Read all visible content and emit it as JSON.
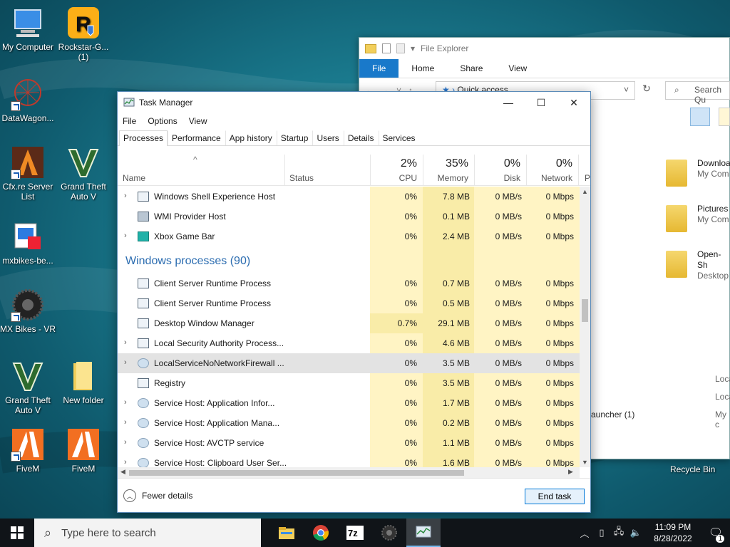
{
  "desktop": {
    "icons": [
      {
        "label": "My Computer"
      },
      {
        "label": "Rockstar-G... (1)"
      },
      {
        "label": "DataWagon..."
      },
      {
        "label": "Cfx.re Server List"
      },
      {
        "label": "Grand Theft Auto V"
      },
      {
        "label": "mxbikes-be..."
      },
      {
        "label": "MX Bikes - VR"
      },
      {
        "label": "Grand Theft Auto V"
      },
      {
        "label": "New folder"
      },
      {
        "label": "FiveM"
      },
      {
        "label": "FiveM"
      }
    ],
    "recycle_label": "Recycle Bin"
  },
  "explorer": {
    "title": "File Explorer",
    "tabs": [
      "File",
      "Home",
      "Share",
      "View"
    ],
    "path": "Quick access",
    "search_placeholder": "Search Qu",
    "items": [
      {
        "name": "Downloa",
        "sub": "My Com"
      },
      {
        "name": "Pictures",
        "sub": "My Com"
      },
      {
        "name": "Open-Sh",
        "sub": "Desktop"
      }
    ],
    "recent": [
      "Loca",
      "Loca",
      "My c"
    ],
    "launcher_label": "auncher (1)"
  },
  "taskmanager": {
    "title": "Task Manager",
    "menu": [
      "File",
      "Options",
      "View"
    ],
    "tabs": [
      "Processes",
      "Performance",
      "App history",
      "Startup",
      "Users",
      "Details",
      "Services"
    ],
    "columns": {
      "name": "Name",
      "status": "Status",
      "cpu": {
        "pct": "2%",
        "label": "CPU"
      },
      "memory": {
        "pct": "35%",
        "label": "Memory"
      },
      "disk": {
        "pct": "0%",
        "label": "Disk"
      },
      "network": {
        "pct": "0%",
        "label": "Network"
      },
      "next": "P"
    },
    "rows_top": [
      {
        "name": "Windows Shell Experience Host",
        "cpu": "0%",
        "mem": "7.8 MB",
        "disk": "0 MB/s",
        "net": "0 Mbps",
        "expand": true,
        "icon": "window"
      },
      {
        "name": "WMI Provider Host",
        "cpu": "0%",
        "mem": "0.1 MB",
        "disk": "0 MB/s",
        "net": "0 Mbps",
        "expand": false,
        "icon": "wmi"
      },
      {
        "name": "Xbox Game Bar",
        "cpu": "0%",
        "mem": "2.4 MB",
        "disk": "0 MB/s",
        "net": "0 Mbps",
        "expand": true,
        "icon": "xbox"
      }
    ],
    "group_label": "Windows processes (90)",
    "rows_win": [
      {
        "name": "Client Server Runtime Process",
        "cpu": "0%",
        "mem": "0.7 MB",
        "disk": "0 MB/s",
        "net": "0 Mbps",
        "expand": false,
        "icon": "window"
      },
      {
        "name": "Client Server Runtime Process",
        "cpu": "0%",
        "mem": "0.5 MB",
        "disk": "0 MB/s",
        "net": "0 Mbps",
        "expand": false,
        "icon": "window"
      },
      {
        "name": "Desktop Window Manager",
        "cpu": "0.7%",
        "mem": "29.1 MB",
        "disk": "0 MB/s",
        "net": "0 Mbps",
        "expand": false,
        "icon": "window"
      },
      {
        "name": "Local Security Authority Process...",
        "cpu": "0%",
        "mem": "4.6 MB",
        "disk": "0 MB/s",
        "net": "0 Mbps",
        "expand": true,
        "icon": "window"
      },
      {
        "name": "LocalServiceNoNetworkFirewall ...",
        "cpu": "0%",
        "mem": "3.5 MB",
        "disk": "0 MB/s",
        "net": "0 Mbps",
        "expand": true,
        "icon": "gear"
      },
      {
        "name": "Registry",
        "cpu": "0%",
        "mem": "3.5 MB",
        "disk": "0 MB/s",
        "net": "0 Mbps",
        "expand": false,
        "icon": "window"
      },
      {
        "name": "Service Host: Application Infor...",
        "cpu": "0%",
        "mem": "1.7 MB",
        "disk": "0 MB/s",
        "net": "0 Mbps",
        "expand": true,
        "icon": "gear"
      },
      {
        "name": "Service Host: Application Mana...",
        "cpu": "0%",
        "mem": "0.2 MB",
        "disk": "0 MB/s",
        "net": "0 Mbps",
        "expand": true,
        "icon": "gear"
      },
      {
        "name": "Service Host: AVCTP service",
        "cpu": "0%",
        "mem": "1.1 MB",
        "disk": "0 MB/s",
        "net": "0 Mbps",
        "expand": true,
        "icon": "gear"
      },
      {
        "name": "Service Host: Clipboard User Ser...",
        "cpu": "0%",
        "mem": "1.6 MB",
        "disk": "0 MB/s",
        "net": "0 Mbps",
        "expand": true,
        "icon": "gear"
      }
    ],
    "fewer_details": "Fewer details",
    "end_task": "End task"
  },
  "taskbar": {
    "search_placeholder": "Type here to search",
    "time": "11:09 PM",
    "date": "8/28/2022"
  },
  "colors": {
    "heat_light": "#fff4c4",
    "heat_mid": "#f9eca8",
    "accent": "#0078d7"
  }
}
